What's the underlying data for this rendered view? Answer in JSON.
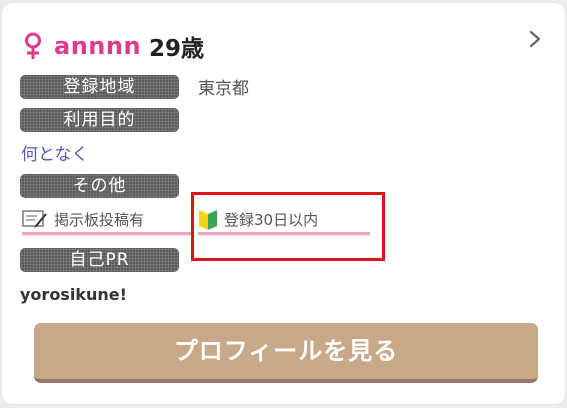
{
  "profile": {
    "username": "annnn",
    "age": "29歳"
  },
  "fields": {
    "region_label": "登録地域",
    "region_value": "東京都",
    "purpose_label": "利用目的",
    "purpose_value": "何となく",
    "other_label": "その他",
    "pr_label": "自己PR",
    "pr_value": "yorosikune!"
  },
  "tags": {
    "board_post": "掲示板投稿有",
    "new_registration": "登録30日以内"
  },
  "actions": {
    "view_profile": "プロフィールを見る"
  },
  "icons": {
    "gender": "female-symbol-icon",
    "chevron": "chevron-right-icon",
    "board": "bulletin-board-memo-icon",
    "beginner": "beginner-mark-icon"
  },
  "colors": {
    "username": "#e0398f",
    "purpose_value": "#5a58b0",
    "label_bg": "#5c5c5c",
    "button_bg": "#c7a888",
    "highlight": "#e0121c",
    "tag_underline": "#e8a6c6"
  }
}
